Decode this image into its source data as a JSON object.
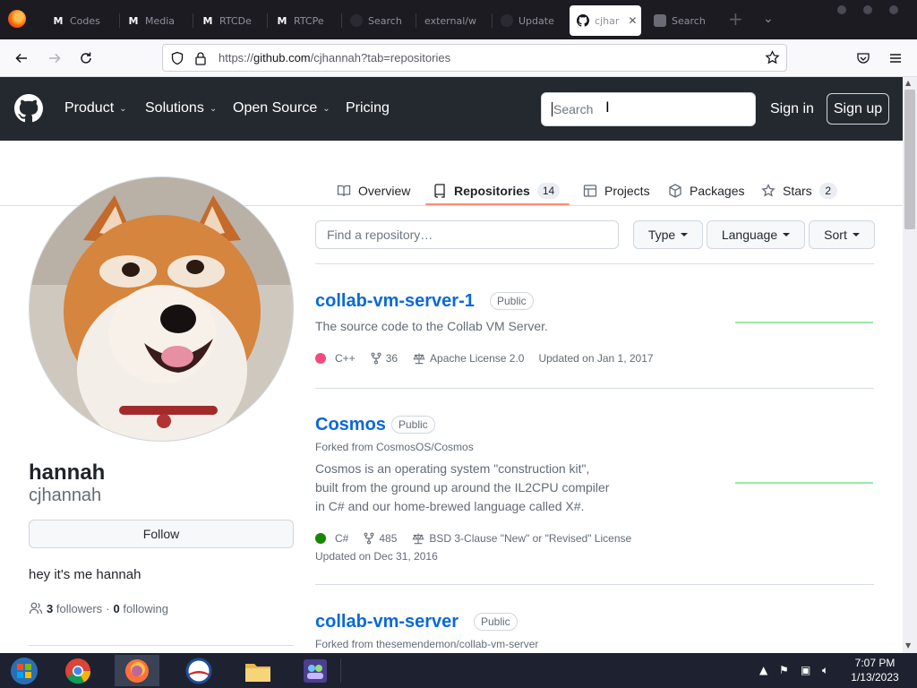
{
  "browser": {
    "tabs": [
      {
        "label": "Codes",
        "icon": "M"
      },
      {
        "label": "Media",
        "icon": "M"
      },
      {
        "label": "RTCDe",
        "icon": "M"
      },
      {
        "label": "RTCPe",
        "icon": "M"
      },
      {
        "label": "Search",
        "icon": ""
      },
      {
        "label": "external/w",
        "icon": ""
      },
      {
        "label": "Update",
        "icon": ""
      },
      {
        "label": "cjhar",
        "icon": "github"
      },
      {
        "label": "Search",
        "icon": ""
      }
    ],
    "active_tab_close": "✕",
    "url_prefix": "https://",
    "url_domain": "github.com",
    "url_path": "/cjhannah?tab=repositories"
  },
  "gh_header": {
    "nav": [
      "Product",
      "Solutions",
      "Open Source",
      "Pricing"
    ],
    "search_placeholder": "Search",
    "sign_in": "Sign in",
    "sign_up": "Sign up"
  },
  "profile_tabs": [
    {
      "label": "Overview",
      "icon": "book-icon"
    },
    {
      "label": "Repositories",
      "icon": "repo-icon",
      "count": "14"
    },
    {
      "label": "Projects",
      "icon": "table-icon"
    },
    {
      "label": "Packages",
      "icon": "package-icon"
    },
    {
      "label": "Stars",
      "icon": "star-icon",
      "count": "2"
    }
  ],
  "profile": {
    "name": "hannah",
    "login": "cjhannah",
    "follow": "Follow",
    "bio": "hey it's me hannah",
    "followers_count": "3",
    "followers_label": "followers",
    "separator": "·",
    "following_count": "0",
    "following_label": "following"
  },
  "repo_filter": {
    "placeholder": "Find a repository…",
    "type": "Type",
    "language": "Language",
    "sort": "Sort"
  },
  "repos": [
    {
      "name": "collab-vm-server-1",
      "visibility": "Public",
      "forked_from": "",
      "desc_lines": [
        "The source code to the Collab VM Server."
      ],
      "language": "C++",
      "language_color": "#f34b7d",
      "forks": "36",
      "license": "Apache License 2.0",
      "updated": "Updated on Jan 1, 2017"
    },
    {
      "name": "Cosmos",
      "visibility": "Public",
      "forked_from": "Forked from CosmosOS/Cosmos",
      "desc_lines": [
        "Cosmos is an operating system \"construction kit\",",
        "built from the ground up around the IL2CPU compiler",
        "in C# and our home-brewed language called X#."
      ],
      "language": "C#",
      "language_color": "#178600",
      "forks": "485",
      "license": "BSD 3-Clause \"New\" or \"Revised\" License",
      "updated": "Updated on Dec 31, 2016"
    },
    {
      "name": "collab-vm-server",
      "visibility": "Public",
      "forked_from": "Forked from thesemendemon/collab-vm-server"
    }
  ],
  "taskbar": {
    "time": "7:07 PM",
    "date": "1/13/2023"
  },
  "colors": {
    "gh_header": "#24292f",
    "link_blue": "#0969da",
    "tab_underline": "#fd8c73",
    "browser_chrome": "#1c1b22"
  }
}
